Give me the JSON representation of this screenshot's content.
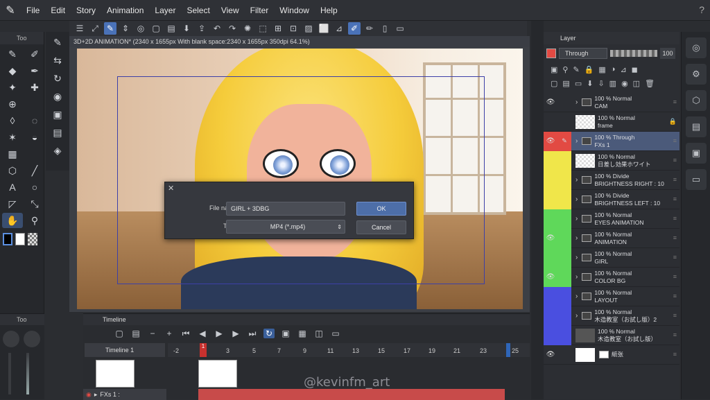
{
  "menu": {
    "items": [
      "File",
      "Edit",
      "Story",
      "Animation",
      "Layer",
      "Select",
      "View",
      "Filter",
      "Window",
      "Help"
    ]
  },
  "canvas": {
    "tab_title": "3D+2D ANIMATION* (2340 x 1655px With blank space:2340 x 1655px 350dpi 64.1%)"
  },
  "dialog": {
    "filename_label": "File name:",
    "filename_value": "GIRL + 3DBG",
    "type_label": "Type:",
    "type_value": "MP4 (*.mp4)",
    "ok_label": "OK",
    "cancel_label": "Cancel"
  },
  "left_panel": {
    "tool_header": "Too",
    "sub_header": "Too"
  },
  "timeline": {
    "tab_label": "Timeline",
    "name": "Timeline 1",
    "ticks": [
      "-2",
      "1",
      "3",
      "5",
      "7",
      "9",
      "11",
      "13",
      "15",
      "17",
      "19",
      "21",
      "23",
      "25"
    ],
    "current_frame": "1",
    "row_label": "FXs 1 :"
  },
  "watermark": "@kevinfm_art",
  "layer_panel": {
    "title": "Layer",
    "blend_mode": "Through",
    "opacity": "100",
    "colors": {
      "red": "#e24a43",
      "yellow": "#f0e64a",
      "green": "#5fd85a",
      "blue": "#4a4fe0"
    },
    "layers": [
      {
        "line1": "100 % Normal",
        "line2": "CAM",
        "color": "none",
        "type": "folder"
      },
      {
        "line1": "100 % Normal",
        "line2": "frame",
        "color": "none",
        "type": "raster"
      },
      {
        "line1": "100 % Through",
        "line2": "FXs 1",
        "color": "red",
        "type": "folder",
        "selected": true
      },
      {
        "line1": "100 % Normal",
        "line2": "日差し効果ホワイト",
        "color": "yellow",
        "type": "raster"
      },
      {
        "line1": "100 % Divide",
        "line2": "BRIGHTNESS RIGHT : 10",
        "color": "yellow",
        "type": "anim"
      },
      {
        "line1": "100 % Divide",
        "line2": "BRIGHTNESS LEFT : 10",
        "color": "yellow",
        "type": "anim"
      },
      {
        "line1": "100 % Normal",
        "line2": "EYES ANIMATION",
        "color": "green",
        "type": "anim"
      },
      {
        "line1": "100 % Normal",
        "line2": "ANIMATION",
        "color": "green",
        "type": "folder"
      },
      {
        "line1": "100 % Normal",
        "line2": "GIRL",
        "color": "green",
        "type": "folder"
      },
      {
        "line1": "100 % Normal",
        "line2": "COLOR BG",
        "color": "green",
        "type": "folder"
      },
      {
        "line1": "100 % Normal",
        "line2": "LAYOUT",
        "color": "blue",
        "type": "folder"
      },
      {
        "line1": "100 % Normal",
        "line2": "木造教室（お試し版）2",
        "color": "blue",
        "type": "folder"
      },
      {
        "line1": "100 % Normal",
        "line2": "木造教室（お試し版）",
        "color": "blue",
        "type": "3d"
      },
      {
        "line1": "",
        "line2": "紙张",
        "color": "none",
        "type": "paper"
      }
    ]
  }
}
